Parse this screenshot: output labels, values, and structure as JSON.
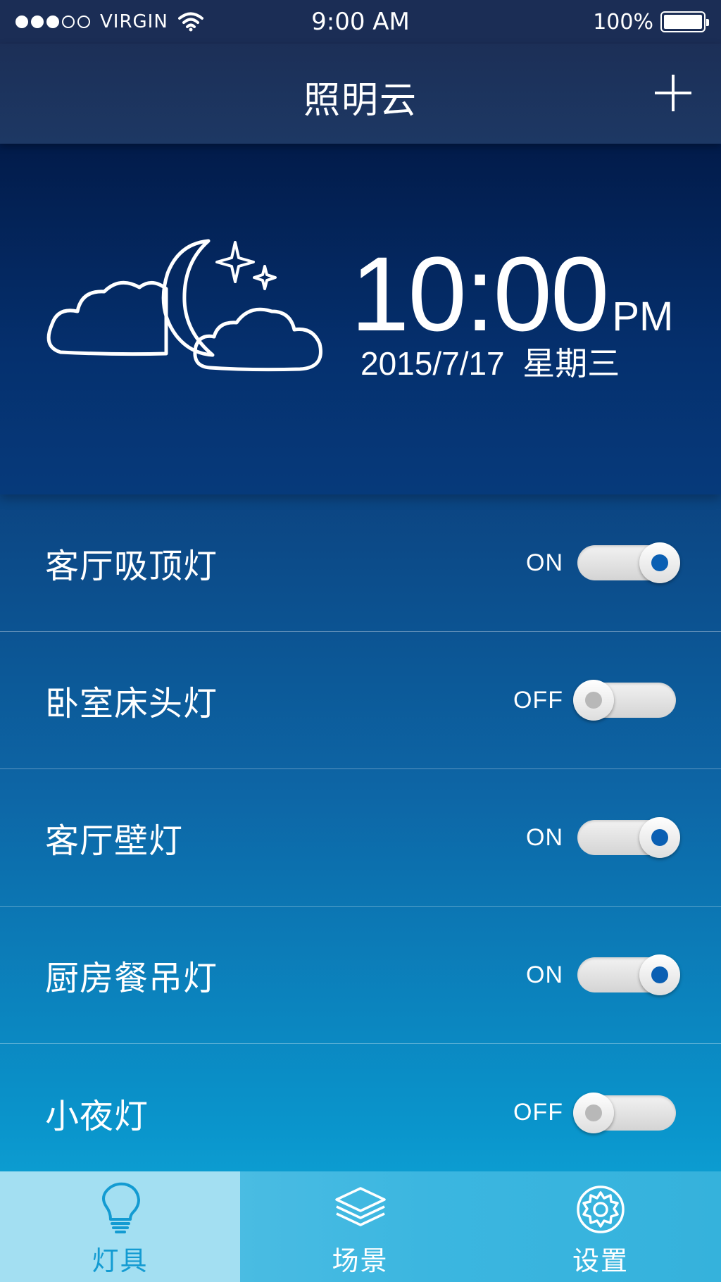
{
  "status_bar": {
    "carrier": "VIRGIN",
    "time": "9:00 AM",
    "battery_text": "100%",
    "battery_level": 1.0,
    "signal_strength": 3
  },
  "nav": {
    "title": "照明云",
    "add_icon": "plus-icon"
  },
  "hero": {
    "weather_icon": "cloud-moon-stars-icon",
    "time": "10:00",
    "ampm": "PM",
    "date": "2015/7/17  星期三"
  },
  "devices": [
    {
      "name": "客厅吸顶灯",
      "state": "ON"
    },
    {
      "name": "卧室床头灯",
      "state": "OFF"
    },
    {
      "name": "客厅壁灯",
      "state": "ON"
    },
    {
      "name": "厨房餐吊灯",
      "state": "ON"
    },
    {
      "name": "小夜灯",
      "state": "OFF"
    }
  ],
  "tabs": [
    {
      "label": "灯具",
      "icon": "bulb-icon",
      "active": true
    },
    {
      "label": "场景",
      "icon": "layers-icon",
      "active": false
    },
    {
      "label": "设置",
      "icon": "gear-icon",
      "active": false
    }
  ],
  "colors": {
    "active_tab_bg": "#a3dff2",
    "active_tab_fg": "#139bd2",
    "toggle_on_dot": "#0a5fb3",
    "toggle_off_dot": "#b8b8b8"
  }
}
